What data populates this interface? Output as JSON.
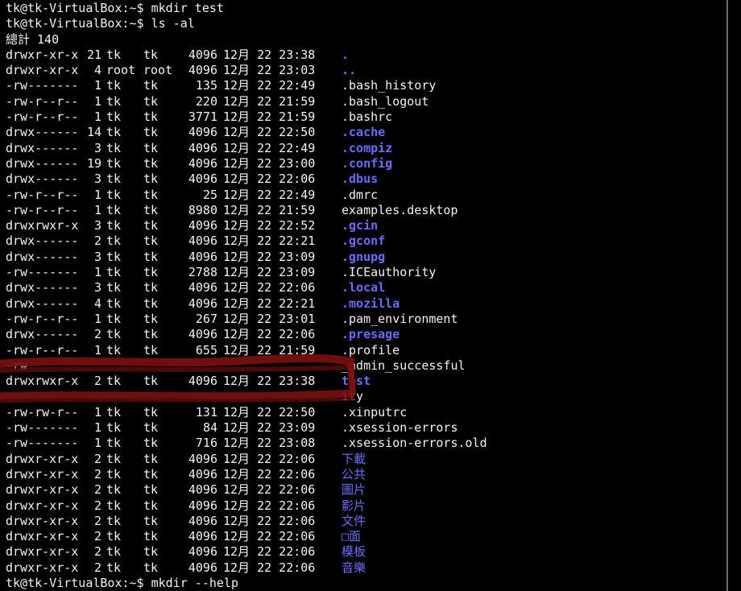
{
  "commands": [
    {
      "prompt": "tk@tk-VirtualBox:~$",
      "command": "mkdir test"
    },
    {
      "prompt": "tk@tk-VirtualBox:~$",
      "command": "ls -al"
    }
  ],
  "total_line": "總計 140",
  "entries": [
    {
      "perms": "drwxr-xr-x",
      "links": "21",
      "owner": "tk",
      "group": "tk",
      "size": "4096",
      "date": "12月 22 23:38",
      "name": ".",
      "is_dir": true
    },
    {
      "perms": "drwxr-xr-x",
      "links": "4",
      "owner": "root",
      "group": "root",
      "size": "4096",
      "date": "12月 22 23:03",
      "name": "..",
      "is_dir": true
    },
    {
      "perms": "-rw-------",
      "links": "1",
      "owner": "tk",
      "group": "tk",
      "size": "135",
      "date": "12月 22 22:49",
      "name": ".bash_history",
      "is_dir": false
    },
    {
      "perms": "-rw-r--r--",
      "links": "1",
      "owner": "tk",
      "group": "tk",
      "size": "220",
      "date": "12月 22 21:59",
      "name": ".bash_logout",
      "is_dir": false
    },
    {
      "perms": "-rw-r--r--",
      "links": "1",
      "owner": "tk",
      "group": "tk",
      "size": "3771",
      "date": "12月 22 21:59",
      "name": ".bashrc",
      "is_dir": false
    },
    {
      "perms": "drwx------",
      "links": "14",
      "owner": "tk",
      "group": "tk",
      "size": "4096",
      "date": "12月 22 22:50",
      "name": ".cache",
      "is_dir": true
    },
    {
      "perms": "drwx------",
      "links": "3",
      "owner": "tk",
      "group": "tk",
      "size": "4096",
      "date": "12月 22 22:49",
      "name": ".compiz",
      "is_dir": true
    },
    {
      "perms": "drwx------",
      "links": "19",
      "owner": "tk",
      "group": "tk",
      "size": "4096",
      "date": "12月 22 23:00",
      "name": ".config",
      "is_dir": true
    },
    {
      "perms": "drwx------",
      "links": "3",
      "owner": "tk",
      "group": "tk",
      "size": "4096",
      "date": "12月 22 22:06",
      "name": ".dbus",
      "is_dir": true
    },
    {
      "perms": "-rw-r--r--",
      "links": "1",
      "owner": "tk",
      "group": "tk",
      "size": "25",
      "date": "12月 22 22:49",
      "name": ".dmrc",
      "is_dir": false
    },
    {
      "perms": "-rw-r--r--",
      "links": "1",
      "owner": "tk",
      "group": "tk",
      "size": "8980",
      "date": "12月 22 21:59",
      "name": "examples.desktop",
      "is_dir": false
    },
    {
      "perms": "drwxrwxr-x",
      "links": "3",
      "owner": "tk",
      "group": "tk",
      "size": "4096",
      "date": "12月 22 22:52",
      "name": ".gcin",
      "is_dir": true
    },
    {
      "perms": "drwx------",
      "links": "2",
      "owner": "tk",
      "group": "tk",
      "size": "4096",
      "date": "12月 22 22:21",
      "name": ".gconf",
      "is_dir": true
    },
    {
      "perms": "drwx------",
      "links": "3",
      "owner": "tk",
      "group": "tk",
      "size": "4096",
      "date": "12月 22 23:09",
      "name": ".gnupg",
      "is_dir": true
    },
    {
      "perms": "-rw-------",
      "links": "1",
      "owner": "tk",
      "group": "tk",
      "size": "2788",
      "date": "12月 22 23:09",
      "name": ".ICEauthority",
      "is_dir": false
    },
    {
      "perms": "drwx------",
      "links": "3",
      "owner": "tk",
      "group": "tk",
      "size": "4096",
      "date": "12月 22 22:06",
      "name": ".local",
      "is_dir": true
    },
    {
      "perms": "drwx------",
      "links": "4",
      "owner": "tk",
      "group": "tk",
      "size": "4096",
      "date": "12月 22 22:21",
      "name": ".mozilla",
      "is_dir": true
    },
    {
      "perms": "-rw-r--r--",
      "links": "1",
      "owner": "tk",
      "group": "tk",
      "size": "267",
      "date": "12月 22 23:01",
      "name": ".pam_environment",
      "is_dir": false
    },
    {
      "perms": "drwx------",
      "links": "2",
      "owner": "tk",
      "group": "tk",
      "size": "4096",
      "date": "12月 22 22:06",
      "name": ".presage",
      "is_dir": true
    },
    {
      "perms": "-rw-r--r--",
      "links": "1",
      "owner": "tk",
      "group": "tk",
      "size": "655",
      "date": "12月 22 21:59",
      "name": ".profile",
      "is_dir": false
    },
    {
      "perms": "-rw",
      "links": "",
      "owner": "",
      "group": "",
      "size": "",
      "date": "",
      "name": "_admin_successful",
      "is_dir": false,
      "obscured": true
    },
    {
      "perms": "drwxrwxr-x",
      "links": "2",
      "owner": "tk",
      "group": "tk",
      "size": "4096",
      "date": "12月 22 23:38",
      "name": "test",
      "is_dir": true,
      "highlighted": true
    },
    {
      "perms": "",
      "links": "",
      "owner": "",
      "group": "",
      "size": "",
      "date": "",
      "name": "ity",
      "is_dir": false,
      "obscured": true
    },
    {
      "perms": "-rw-rw-r--",
      "links": "1",
      "owner": "tk",
      "group": "tk",
      "size": "131",
      "date": "12月 22 22:50",
      "name": ".xinputrc",
      "is_dir": false
    },
    {
      "perms": "-rw-------",
      "links": "1",
      "owner": "tk",
      "group": "tk",
      "size": "84",
      "date": "12月 22 23:09",
      "name": ".xsession-errors",
      "is_dir": false
    },
    {
      "perms": "-rw-------",
      "links": "1",
      "owner": "tk",
      "group": "tk",
      "size": "716",
      "date": "12月 22 23:08",
      "name": ".xsession-errors.old",
      "is_dir": false
    },
    {
      "perms": "drwxr-xr-x",
      "links": "2",
      "owner": "tk",
      "group": "tk",
      "size": "4096",
      "date": "12月 22 22:06",
      "name": "下載",
      "is_dir": true,
      "cjk": true
    },
    {
      "perms": "drwxr-xr-x",
      "links": "2",
      "owner": "tk",
      "group": "tk",
      "size": "4096",
      "date": "12月 22 22:06",
      "name": "公共",
      "is_dir": true,
      "cjk": true
    },
    {
      "perms": "drwxr-xr-x",
      "links": "2",
      "owner": "tk",
      "group": "tk",
      "size": "4096",
      "date": "12月 22 22:06",
      "name": "圖片",
      "is_dir": true,
      "cjk": true
    },
    {
      "perms": "drwxr-xr-x",
      "links": "2",
      "owner": "tk",
      "group": "tk",
      "size": "4096",
      "date": "12月 22 22:06",
      "name": "影片",
      "is_dir": true,
      "cjk": true
    },
    {
      "perms": "drwxr-xr-x",
      "links": "2",
      "owner": "tk",
      "group": "tk",
      "size": "4096",
      "date": "12月 22 22:06",
      "name": "文件",
      "is_dir": true,
      "cjk": true
    },
    {
      "perms": "drwxr-xr-x",
      "links": "2",
      "owner": "tk",
      "group": "tk",
      "size": "4096",
      "date": "12月 22 22:06",
      "name": "□面",
      "is_dir": true,
      "cjk": true
    },
    {
      "perms": "drwxr-xr-x",
      "links": "2",
      "owner": "tk",
      "group": "tk",
      "size": "4096",
      "date": "12月 22 22:06",
      "name": "模板",
      "is_dir": true,
      "cjk": true
    },
    {
      "perms": "drwxr-xr-x",
      "links": "2",
      "owner": "tk",
      "group": "tk",
      "size": "4096",
      "date": "12月 22 22:06",
      "name": "音樂",
      "is_dir": true,
      "cjk": true
    }
  ],
  "final_command": {
    "prompt": "tk@tk-VirtualBox:~$",
    "command": "mkdir --help"
  },
  "colors": {
    "background": "#000000",
    "text": "#f2f2f2",
    "directory": "#6b6bff",
    "annotation": "#7a1010"
  }
}
